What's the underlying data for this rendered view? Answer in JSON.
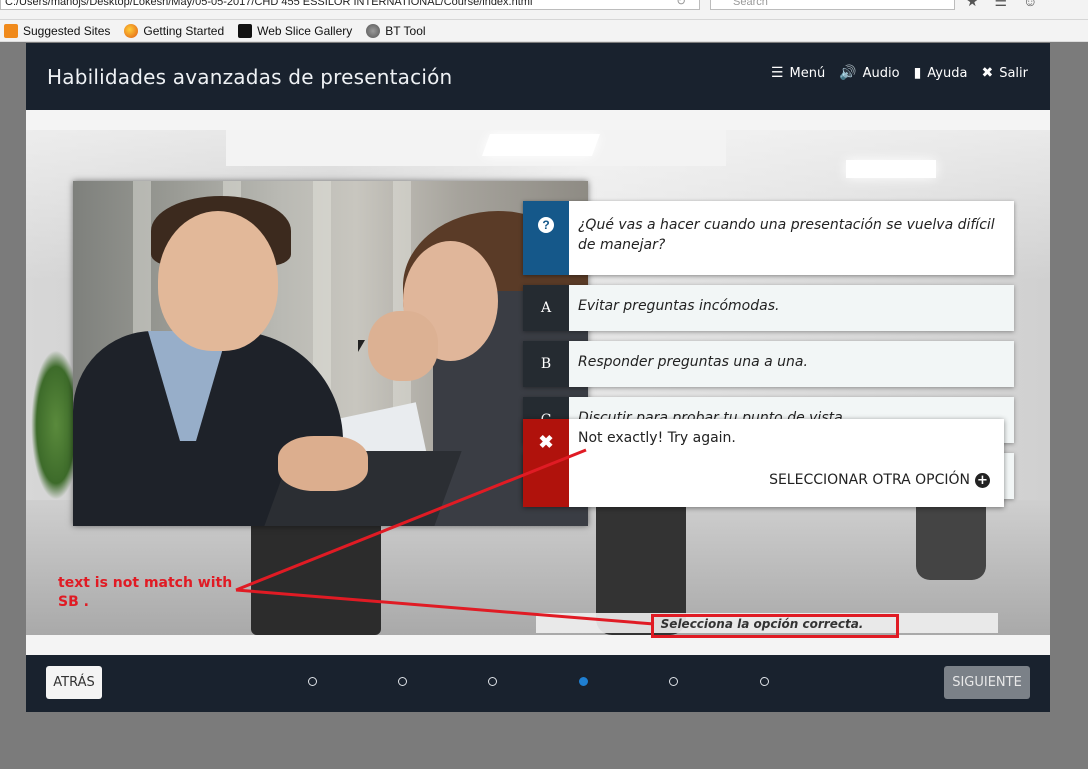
{
  "browser": {
    "url": "C:/Users/manojs/Desktop/Lokesh/May/05-05-2017/CHD 455 ESSILOR INTERNATIONAL/Course/index.html",
    "search_placeholder": "Search",
    "favorites": [
      "Suggested Sites",
      "Getting Started",
      "Web Slice Gallery",
      "BT Tool"
    ]
  },
  "course": {
    "title": "Habilidades avanzadas de presentación",
    "nav": {
      "menu": "Menú",
      "audio": "Audio",
      "help": "Ayuda",
      "exit": "Salir"
    }
  },
  "question": {
    "icon": "question-icon",
    "text": "¿Qué vas a hacer cuando una presentación se vuelva difícil de manejar?",
    "options": [
      {
        "letter": "A",
        "text": "Evitar preguntas incómodas."
      },
      {
        "letter": "B",
        "text": "Responder preguntas una a una."
      },
      {
        "letter": "C",
        "text": "Discutir para probar tu punto de vista."
      }
    ],
    "instruction": "Selecciona la opción correcta."
  },
  "feedback": {
    "icon": "close-icon",
    "message": "Not exactly! Try again.",
    "retry_label": "SELECCIONAR OTRA OPCIÓN",
    "color": "#b0120c"
  },
  "bottom": {
    "back_label": "ATRÁS",
    "next_label": "SIGUIENTE",
    "page_dots": 6,
    "active_dot": 4
  },
  "annotation": {
    "line1": "text is not match with",
    "line2": "SB .",
    "color": "#e01b24"
  },
  "colors": {
    "header": "#19222e",
    "accent_blue": "#15588a",
    "dot_active": "#1f7fd1"
  }
}
